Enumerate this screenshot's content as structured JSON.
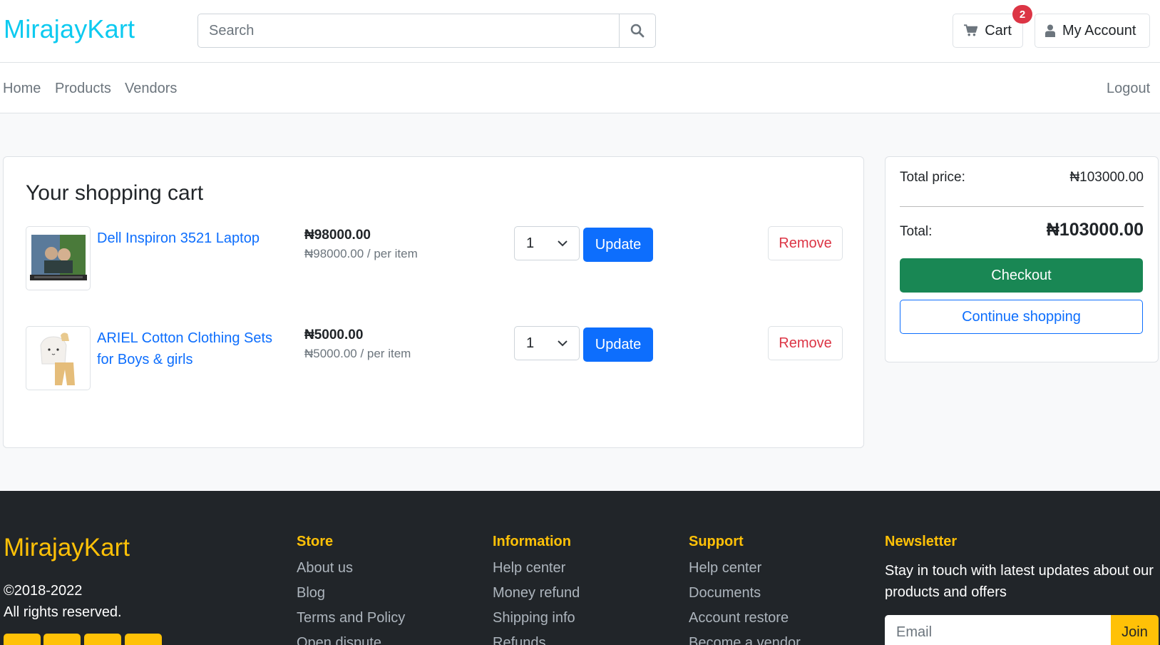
{
  "header": {
    "brand": "MirajayKart",
    "search_placeholder": "Search",
    "cart_label": "Cart",
    "cart_count": "2",
    "account_label": "My Account"
  },
  "nav": {
    "home": "Home",
    "products": "Products",
    "vendors": "Vendors",
    "logout": "Logout"
  },
  "cart": {
    "title": "Your shopping cart",
    "items": [
      {
        "name": "Dell Inspiron 3521 Laptop",
        "price": "₦98000.00",
        "unit_price": "₦98000.00 / per item",
        "qty": "1",
        "update_label": "Update",
        "remove_label": "Remove"
      },
      {
        "name": "ARIEL Cotton Clothing Sets for Boys & girls",
        "price": "₦5000.00",
        "unit_price": "₦5000.00 / per item",
        "qty": "1",
        "update_label": "Update",
        "remove_label": "Remove"
      }
    ]
  },
  "summary": {
    "total_price_label": "Total price:",
    "total_price_value": "₦103000.00",
    "total_label": "Total:",
    "total_value": "₦103000.00",
    "checkout_label": "Checkout",
    "continue_label": "Continue shopping"
  },
  "footer": {
    "brand": "MirajayKart",
    "copyright": "©2018-2022",
    "rights": "All rights reserved.",
    "store": {
      "title": "Store",
      "links": [
        "About us",
        "Blog",
        "Terms and Policy",
        "Open dispute"
      ]
    },
    "information": {
      "title": "Information",
      "links": [
        "Help center",
        "Money refund",
        "Shipping info",
        "Refunds"
      ]
    },
    "support": {
      "title": "Support",
      "links": [
        "Help center",
        "Documents",
        "Account restore",
        "Become a vendor"
      ]
    },
    "newsletter": {
      "title": "Newsletter",
      "text": "Stay in touch with latest updates about our products and offers",
      "email_placeholder": "Email",
      "join_label": "Join"
    }
  },
  "colors": {
    "brand": "#0dcaf0",
    "primary": "#0d6efd",
    "success": "#198754",
    "danger": "#dc3545",
    "footer_accent": "#ffc107",
    "footer_bg": "#212529"
  },
  "icons": [
    "search-icon",
    "cart-icon",
    "user-icon",
    "chevron-down-icon"
  ]
}
